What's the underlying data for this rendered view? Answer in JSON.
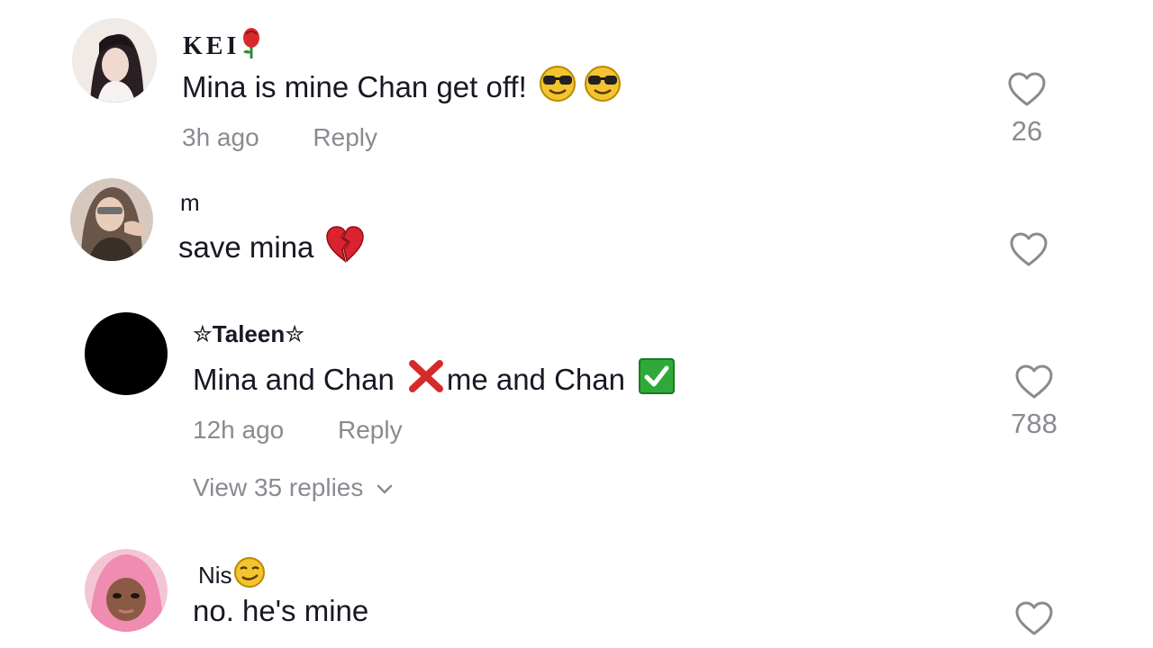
{
  "comments": [
    {
      "username": "KEI",
      "username_emoji": "rose-icon",
      "text": "Mina is mine Chan get off!",
      "text_emoji": "sunglasses-face-icon",
      "time": "3h ago",
      "reply_label": "Reply",
      "like_count": "26"
    },
    {
      "username": "m",
      "text": "save mina",
      "text_emoji": "broken-heart-icon",
      "like_count": ""
    },
    {
      "username_prefix": "✮",
      "username": "Taleen",
      "username_suffix": "✮",
      "text_part1": "Mina and Chan",
      "text_part2": "me and Chan",
      "time": "12h ago",
      "reply_label": "Reply",
      "like_count": "788",
      "view_replies": "View 35 replies"
    },
    {
      "username": "Nis",
      "username_emoji": "smirk-face-icon",
      "text": "no. he's mine",
      "like_count": ""
    }
  ],
  "colors": {
    "text": "#161823",
    "secondary": "#8a8b91",
    "heart_outline": "#8a8b91"
  }
}
